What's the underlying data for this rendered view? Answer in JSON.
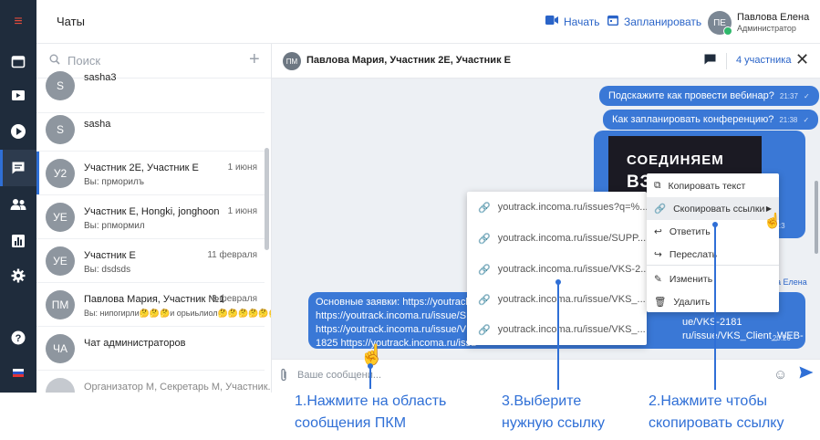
{
  "rail": {
    "icons": [
      "menu-icon",
      "calendar-icon",
      "video-icon",
      "play-icon",
      "chat-icon",
      "users-icon",
      "chart-icon",
      "gear-icon",
      "help-icon",
      "flag-icon"
    ]
  },
  "header": {
    "title": "Чаты",
    "start_label": "Начать",
    "schedule_label": "Запланировать",
    "user_initials": "ПЕ",
    "user_name": "Павлова Елена",
    "user_role": "Администратор"
  },
  "list": {
    "search_placeholder": "Поиск",
    "chats": [
      {
        "initials": "S",
        "name": "sasha3",
        "preview": "",
        "date": ""
      },
      {
        "initials": "S",
        "name": "sasha",
        "preview": "",
        "date": ""
      },
      {
        "initials": "У2",
        "name": "Участник 2Е, Участник Е",
        "preview": "Вы: прморилъ",
        "date": "1 июня"
      },
      {
        "initials": "УЕ",
        "name": "Участник Е, Hongki, jonghoon",
        "preview": "Вы: рпмормил",
        "date": "1 июня"
      },
      {
        "initials": "УЕ",
        "name": "Участник Е",
        "preview": "Вы: dsdsds",
        "date": "11 февраля"
      },
      {
        "initials": "ПМ",
        "name": "Павлова Мария, Участник №1",
        "preview": "Вы: нипогирли🤔🤔🤔и орьиьлиол🤔🤔🤔🤔🤔🤔",
        "date": "8 февраля"
      },
      {
        "initials": "ЧА",
        "name": "Чат администраторов",
        "preview": "",
        "date": ""
      },
      {
        "initials": "",
        "name": "Организатор М, Секретарь М, Участник...",
        "preview": "",
        "date": ""
      }
    ]
  },
  "chat": {
    "avatar_initials": "ПМ",
    "title": "Павлова Мария, Участник 2Е, Участник Е",
    "participants": "4 участника",
    "messages": [
      {
        "text": "Подскажите как провести вебинар?",
        "time": "21:37"
      },
      {
        "text": "Как запланировать конференцию?",
        "time": "21:38"
      }
    ],
    "image_line1": "СОЕДИНЯЕМ",
    "image_line2": "ВЗГЛЯДЫ",
    "image_time": "21:3",
    "sender": "а Елена",
    "long_message_left": "Основные заявки: https://youtrack.\nhttps://youtrack.incoma.ru/issue/SU\nhttps://youtrack.incoma.ru/issue/VK\n1825 https://youtrack.incoma.ru/issu",
    "long_message_right": "ue/VKS-2181\nru/issue/VKS_Client_WEB-",
    "long_time": "20:20",
    "compose_placeholder": "Ваше сообщени..."
  },
  "links_menu": [
    "youtrack.incoma.ru/issues?q=%...",
    "youtrack.incoma.ru/issue/SUPP...",
    "youtrack.incoma.ru/issue/VKS-2...",
    "youtrack.incoma.ru/issue/VKS_...",
    "youtrack.incoma.ru/issue/VKS_..."
  ],
  "context_menu": [
    {
      "label": "Копировать текст",
      "icon": "copy-icon"
    },
    {
      "label": "Скопировать ссылки",
      "icon": "link-icon"
    },
    {
      "label": "Ответить",
      "icon": "reply-icon"
    },
    {
      "label": "Переслать",
      "icon": "forward-icon"
    },
    {
      "label": "Изменить",
      "icon": "edit-icon"
    },
    {
      "label": "Удалить",
      "icon": "trash-icon"
    }
  ],
  "callouts": {
    "step1": "1.Нажмите на область\nсообщения ПКМ",
    "step3": "3.Выберите\nнужную ссылку",
    "step2": "2.Нажмите чтобы\nскопировать ссылку"
  },
  "colors": {
    "accent": "#2f6fd6",
    "rail": "#1f2c3c",
    "bubble": "#3a78d6"
  }
}
